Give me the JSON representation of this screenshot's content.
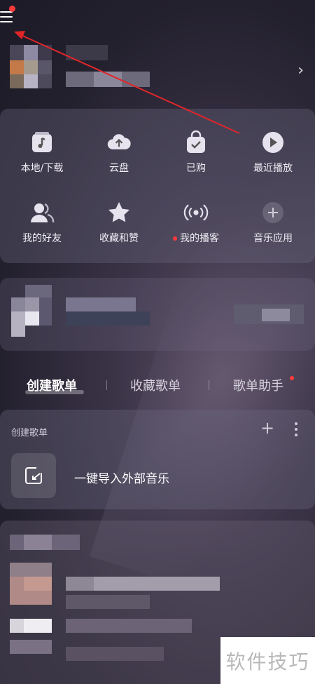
{
  "header": {
    "menu_icon": "hamburger-menu-icon",
    "profile_chevron": "›"
  },
  "quick_access": {
    "items": [
      {
        "label": "本地/下载",
        "icon": "local-download-icon"
      },
      {
        "label": "云盘",
        "icon": "cloud-upload-icon"
      },
      {
        "label": "已购",
        "icon": "shopping-bag-icon"
      },
      {
        "label": "最近播放",
        "icon": "play-circle-icon"
      },
      {
        "label": "我的好友",
        "icon": "friends-icon"
      },
      {
        "label": "收藏和赞",
        "icon": "star-icon"
      },
      {
        "label": "我的播客",
        "icon": "podcast-icon"
      },
      {
        "label": "音乐应用",
        "icon": "plus-circle-icon"
      }
    ]
  },
  "tabs": [
    {
      "label": "创建歌单"
    },
    {
      "label": "收藏歌单"
    },
    {
      "label": "歌单助手"
    }
  ],
  "playlists": {
    "header": "创建歌单",
    "add_symbol": "+",
    "import_label": "一键导入外部音乐"
  },
  "watermark": "软件技巧",
  "colors": {
    "accent_red": "#ff3a3a",
    "annotation_arrow": "#e0262a"
  }
}
